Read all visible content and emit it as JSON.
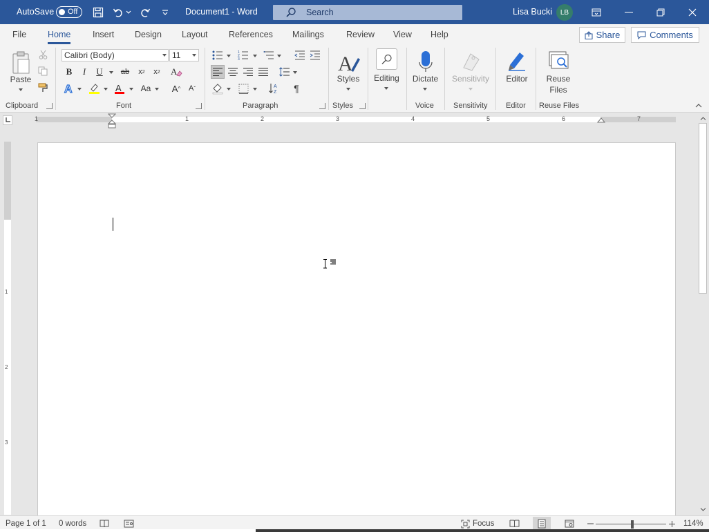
{
  "titlebar": {
    "autosave_label": "AutoSave",
    "autosave_state": "Off",
    "doc_title": "Document1  -  Word",
    "search_placeholder": "Search",
    "user_name": "Lisa Bucki",
    "user_initials": "LB"
  },
  "tabs": [
    {
      "label": "File"
    },
    {
      "label": "Home"
    },
    {
      "label": "Insert"
    },
    {
      "label": "Design"
    },
    {
      "label": "Layout"
    },
    {
      "label": "References"
    },
    {
      "label": "Mailings"
    },
    {
      "label": "Review"
    },
    {
      "label": "View"
    },
    {
      "label": "Help"
    }
  ],
  "share_label": "Share",
  "comments_label": "Comments",
  "ribbon": {
    "clipboard": {
      "label": "Clipboard",
      "paste": "Paste"
    },
    "font": {
      "label": "Font",
      "font_name": "Calibri (Body)",
      "font_size": "11"
    },
    "paragraph": {
      "label": "Paragraph"
    },
    "styles": {
      "label": "Styles",
      "styles_button": "Styles"
    },
    "editing": {
      "label": "Editing"
    },
    "voice": {
      "label": "Voice",
      "dictate": "Dictate"
    },
    "sensitivity": {
      "label": "Sensitivity",
      "button": "Sensitivity"
    },
    "editor": {
      "label": "Editor",
      "button": "Editor"
    },
    "reuse": {
      "label": "Reuse Files",
      "button_line1": "Reuse",
      "button_line2": "Files"
    }
  },
  "ruler_numbers": [
    "1",
    "1",
    "2",
    "3",
    "4",
    "5",
    "6",
    "7"
  ],
  "vruler_numbers": [
    "1",
    "2",
    "3"
  ],
  "status": {
    "page": "Page 1 of 1",
    "words": "0 words",
    "focus": "Focus",
    "zoom": "114%"
  },
  "colors": {
    "brand": "#2b579a",
    "highlight": "#ffff00",
    "font_color": "#ff0000",
    "avatar": "#357d6b"
  }
}
